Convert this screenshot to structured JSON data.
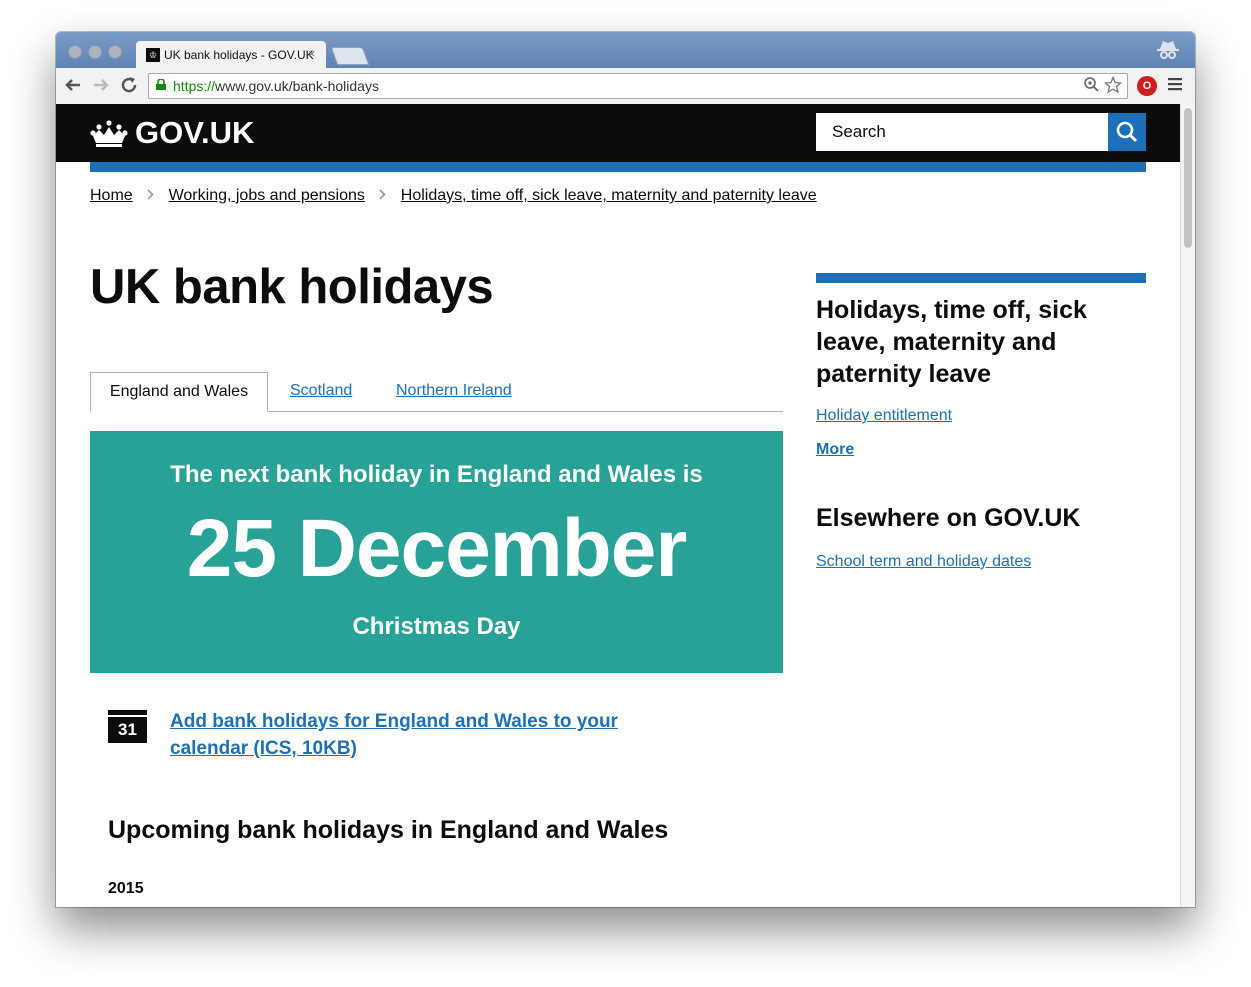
{
  "browser": {
    "tab_title": "UK bank holidays - GOV.UK",
    "tab_close": "×",
    "favicon_label": "♔",
    "url_scheme": "https://",
    "url_rest": "www.gov.uk/bank-holidays",
    "ext_label": "O"
  },
  "header": {
    "logo_text": "GOV.UK",
    "search_placeholder": "Search"
  },
  "breadcrumb": [
    "Home",
    "Working, jobs and pensions",
    "Holidays, time off, sick leave, maternity and paternity leave"
  ],
  "page": {
    "title": "UK bank holidays",
    "tabs": [
      "England and Wales",
      "Scotland",
      "Northern Ireland"
    ],
    "next_holiday": {
      "intro": "The next bank holiday in England and Wales is",
      "date": "25 December",
      "name": "Christmas Day"
    },
    "calendar": {
      "icon_label": "31",
      "link_text": "Add bank holidays for England and Wales to your calendar (ICS, 10KB)"
    },
    "upcoming_heading": "Upcoming bank holidays in England and Wales",
    "year": "2015"
  },
  "sidebar": {
    "related_heading": "Holidays, time off, sick leave, maternity and paternity leave",
    "related_link": "Holiday entitlement",
    "more_link": "More",
    "elsewhere_heading": "Elsewhere on GOV.UK",
    "elsewhere_link": "School term and holiday dates"
  },
  "colors": {
    "header_black": "#0b0c0c",
    "brand_blue": "#1d70b8",
    "panel_turquoise": "#28a197",
    "link_blue": "#1d70b8"
  }
}
